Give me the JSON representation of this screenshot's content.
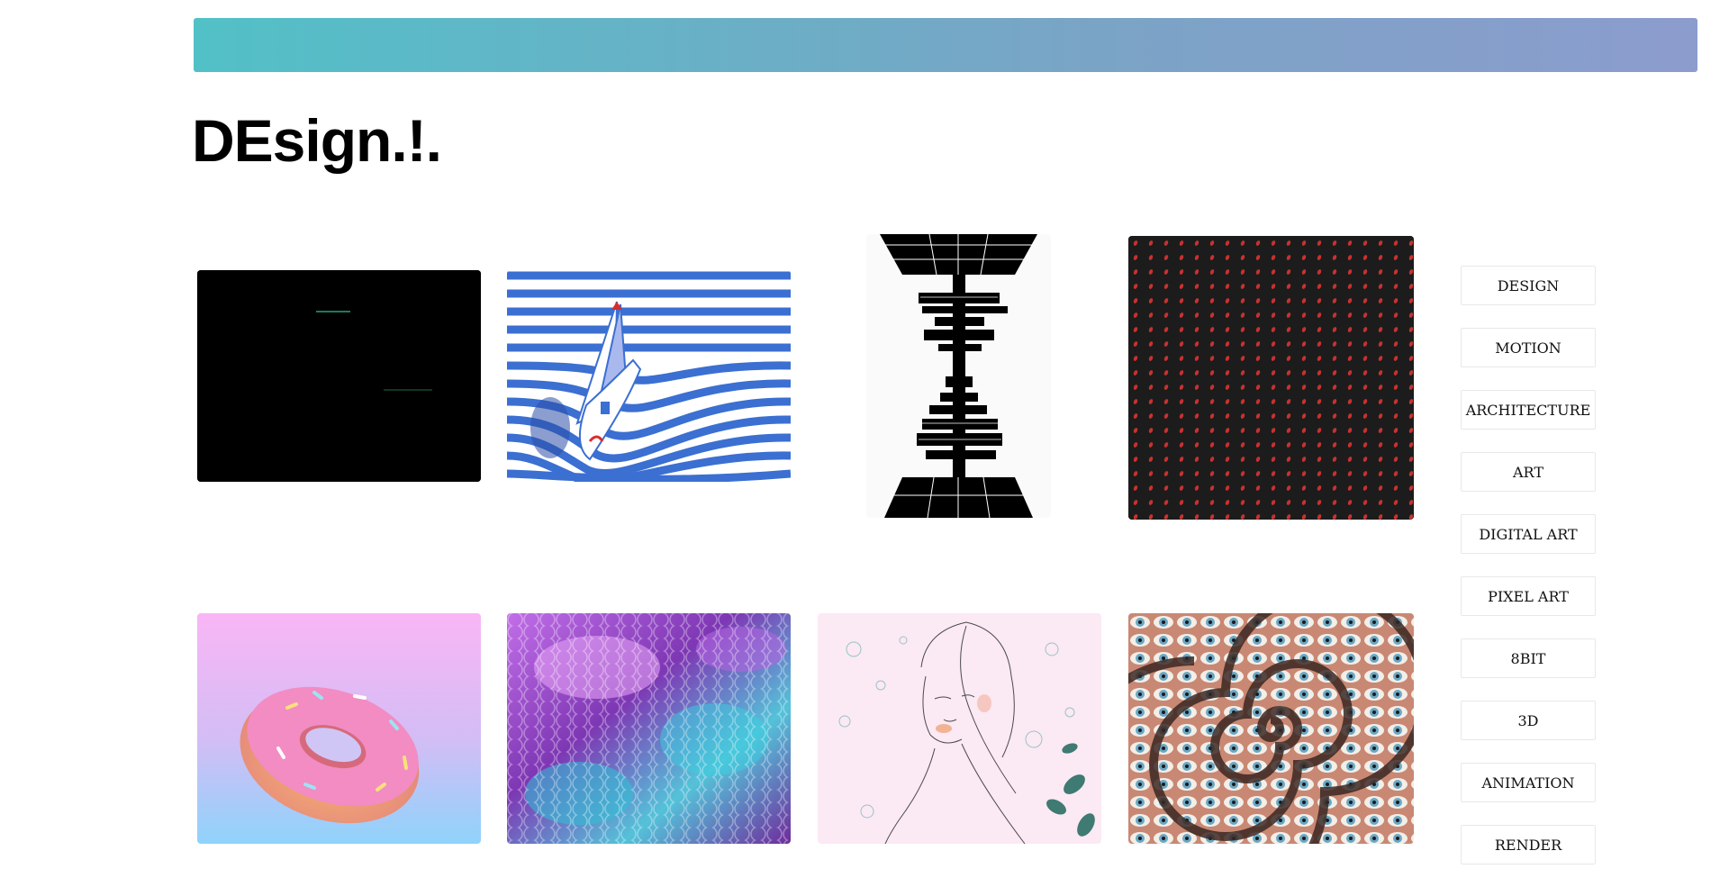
{
  "site": {
    "title": "DEsign.!."
  },
  "gallery": {
    "tiles": [
      {
        "name": "black-glitch-artwork",
        "subject": "black screen with thin green lines"
      },
      {
        "name": "sailboat-stripes-artwork",
        "subject": "sailboat on blue and white striped waves"
      },
      {
        "name": "hourglass-tower-artwork",
        "subject": "black and white hourglass tower"
      },
      {
        "name": "red-dot-pattern-artwork",
        "subject": "red dots on dark background"
      },
      {
        "name": "donut-artwork",
        "subject": "pink frosted donut on pastel gradient"
      },
      {
        "name": "sequin-artwork",
        "subject": "purple and cyan sequin surface"
      },
      {
        "name": "line-portrait-artwork",
        "subject": "line drawing portrait of a woman"
      },
      {
        "name": "eye-spiral-artwork",
        "subject": "spiral of eyes"
      }
    ]
  },
  "tags": [
    "DESIGN",
    "MOTION",
    "ARCHITECTURE",
    "ART",
    "DIGITAL ART",
    "PIXEL ART",
    "8BIT",
    "3D",
    "ANIMATION",
    "RENDER"
  ]
}
